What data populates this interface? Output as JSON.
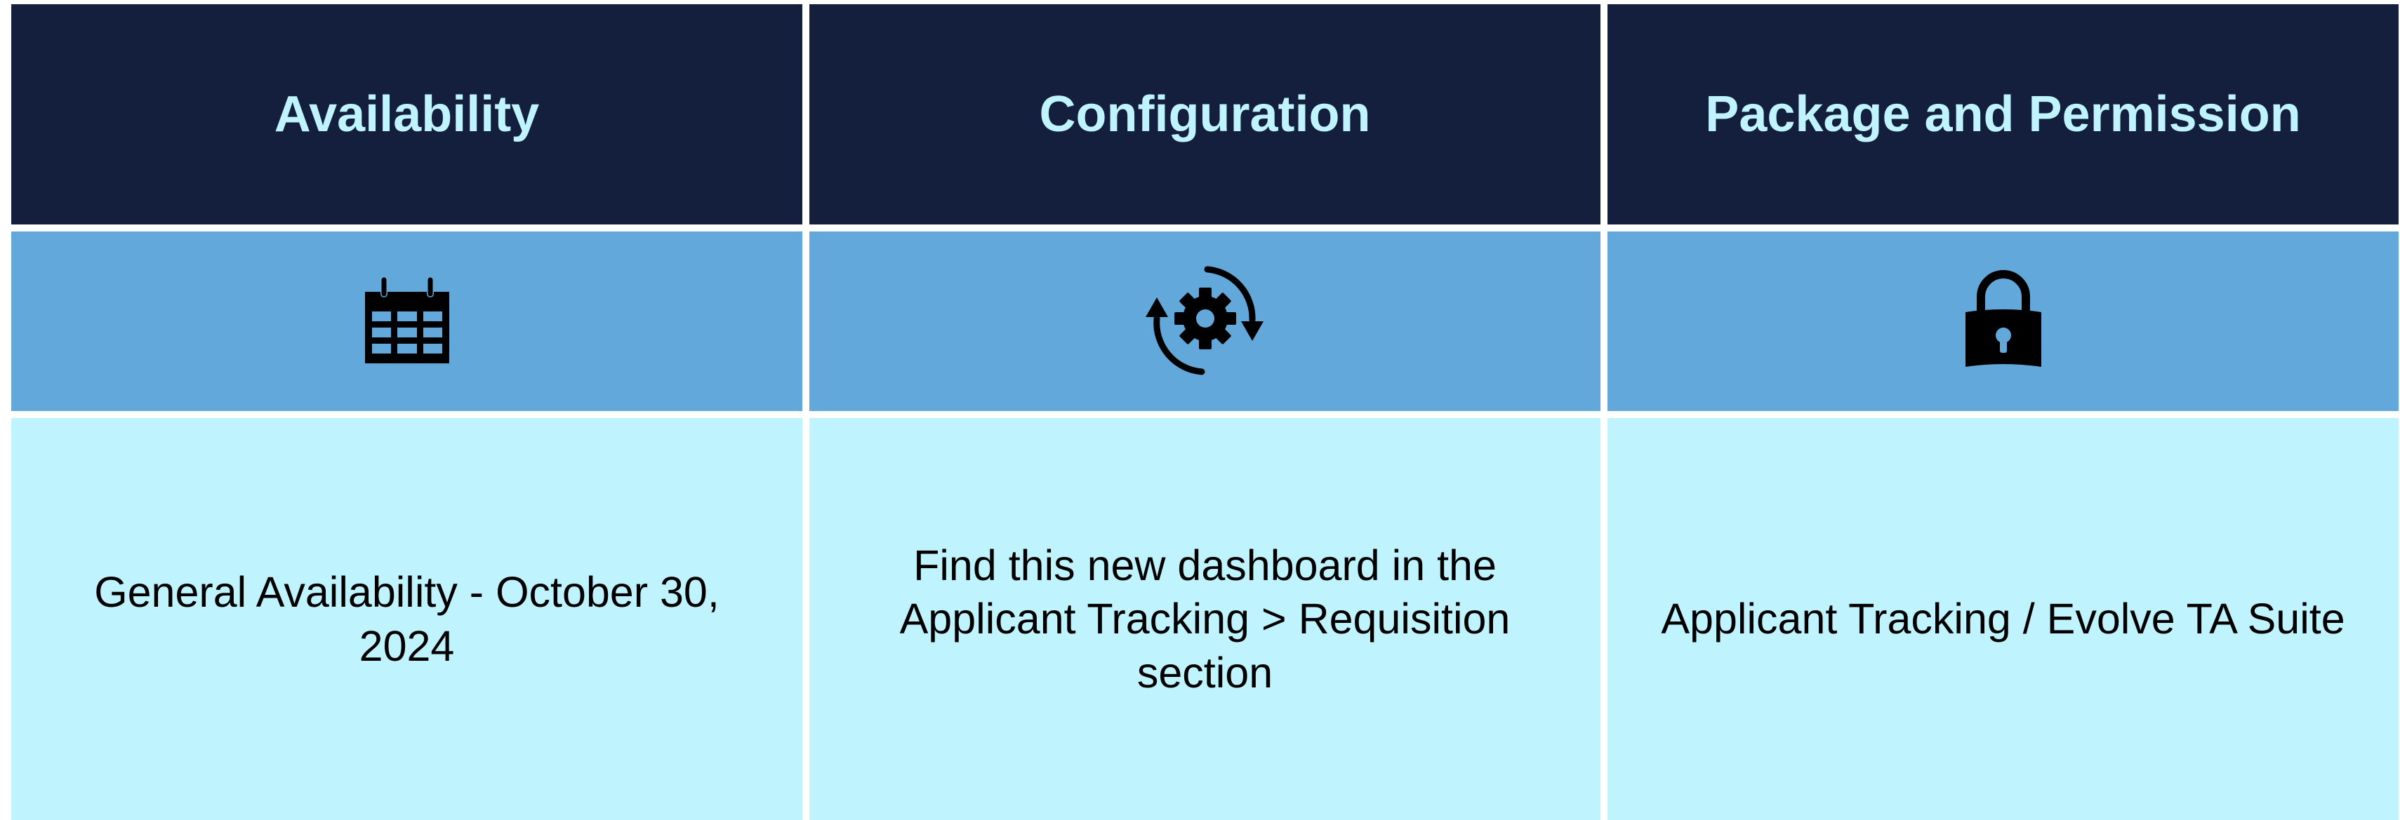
{
  "columns": [
    {
      "header": "Availability",
      "icon": "calendar-icon",
      "body": "General Availability - October 30, 2024"
    },
    {
      "header": "Configuration",
      "icon": "gear-cycle-icon",
      "body": "Find this new dashboard in the Applicant Tracking > Requisition section"
    },
    {
      "header": "Package and Permission",
      "icon": "lock-icon",
      "body": "Applicant Tracking / Evolve TA Suite"
    }
  ],
  "colors": {
    "header_bg": "#131f3d",
    "header_text": "#bff3fd",
    "icon_row_bg": "#63a8da",
    "body_bg": "#bff3fd",
    "body_text": "#000000",
    "icon_fill": "#000000"
  }
}
